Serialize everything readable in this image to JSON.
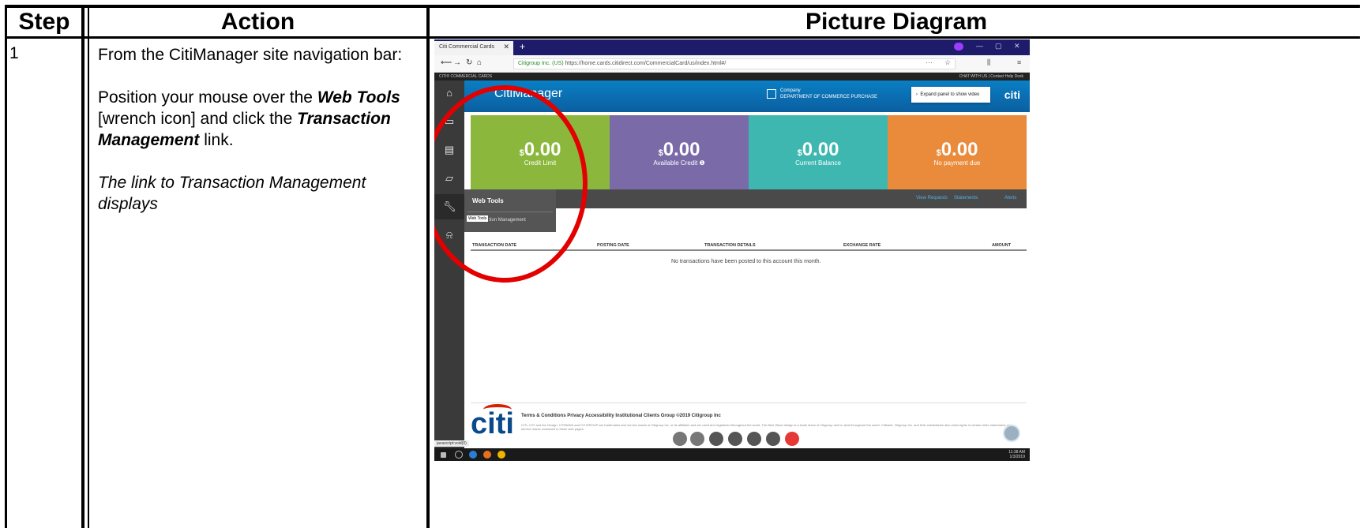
{
  "headers": {
    "step": "Step",
    "action": "Action",
    "picture": "Picture Diagram"
  },
  "row": {
    "step_number": "1",
    "intro": "From the CitiManager site navigation bar:",
    "instr_pre": "Position your mouse over the ",
    "instr_web_tools": "Web Tools",
    "instr_mid": " [wrench icon] and click the ",
    "instr_tm": "Transaction Management",
    "instr_post": " link.",
    "note": "The link to Transaction Management displays"
  },
  "screenshot": {
    "tab_title": "Citi Commercial Cards",
    "url_org": "Citigroup Inc. (US)",
    "url": "https://home.cards.citidirect.com/CommercialCard/us/index.html#/",
    "top_strip_left": "CITI® COMMERCIAL CARDS",
    "top_strip_right": "CHAT WITH US  |  Contact Help Desk",
    "app_title": "CitiManager",
    "company_label": "Company",
    "company_name": "DEPARTMENT OF COMMERCE PURCHASE",
    "expand_panel": "Expand panel to show video",
    "brand": "citi",
    "tiles": [
      {
        "currency": "$",
        "amount": "0.00",
        "label": "Credit Limit",
        "color": "#8bb83c"
      },
      {
        "currency": "$",
        "amount": "0.00",
        "label": "Available Credit",
        "color": "#7a6aa8"
      },
      {
        "currency": "$",
        "amount": "0.00",
        "label": "Current Balance",
        "color": "#3db7b0"
      },
      {
        "currency": "$",
        "amount": "0.00",
        "label": "No payment due",
        "color": "#e98b3a"
      }
    ],
    "links": [
      "View Requests",
      "Statements",
      "Alerts"
    ],
    "menu_title": "Web Tools",
    "menu_item": "Transaction Management",
    "tooltip": "Web Tools",
    "table_headers": [
      "TRANSACTION DATE",
      "POSTING DATE",
      "TRANSACTION DETAILS",
      "EXCHANGE RATE",
      "AMOUNT"
    ],
    "empty_message": "No transactions have been posted to this account this month.",
    "footer_links": "Terms & Conditions   Privacy   Accessibility   Institutional Clients Group     ©2019 Citigroup Inc",
    "footer_fine": "CITI, CITI and Arc Design, CITIBANK and CITIGROUP are trademarks and service marks of Citigroup Inc. or its affiliates and are used and registered throughout the world. The Blue Wave design is a trade dress of Citigroup and is used throughout the world. Citibank, Citigroup Inc. and their subsidiaries also claim rights in certain other trademarks and service marks contained in these web pages.",
    "status_url": "javascript:void(0)",
    "clock_time": "11:38 AM",
    "clock_date": "1/3/2019",
    "highlight_color": "#e20000"
  }
}
